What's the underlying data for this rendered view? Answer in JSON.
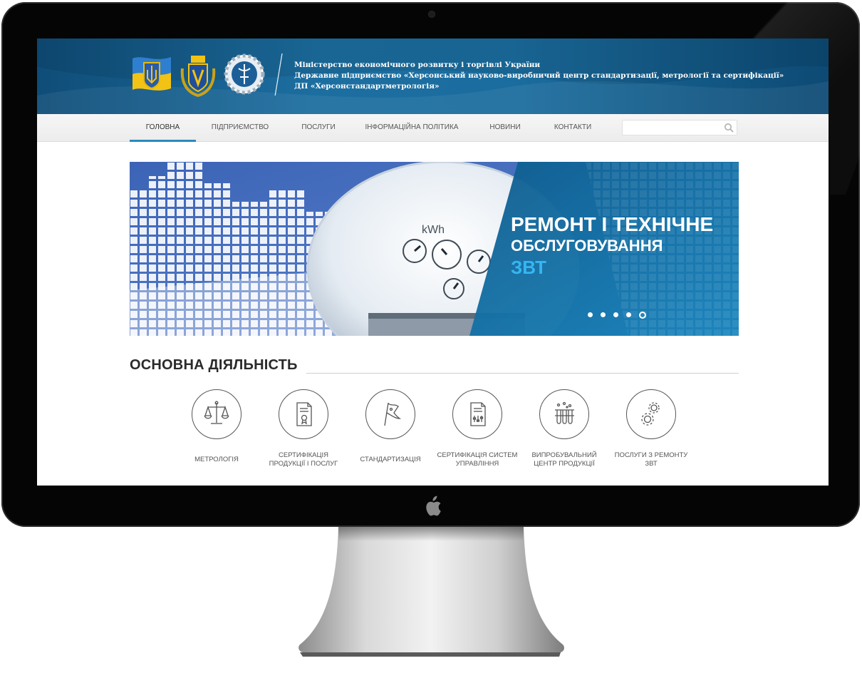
{
  "header": {
    "line1": "Міністерство економічного розвитку і торгівлі України",
    "line2": "Державне підприємство «Херсонський науково-виробничий центр стандартизації, метрології та сертифікації»",
    "line3": "ДП «Херсонстандартметрологія»"
  },
  "nav": {
    "items": [
      {
        "label": "ГОЛОВНА",
        "active": true
      },
      {
        "label": "ПІДПРИЄМСТВО",
        "active": false
      },
      {
        "label": "ПОСЛУГИ",
        "active": false
      },
      {
        "label": "ІНФОРМАЦІЙНА ПОЛІТИКА",
        "active": false
      },
      {
        "label": "НОВИНИ",
        "active": false
      },
      {
        "label": "КОНТАКТИ",
        "active": false
      }
    ],
    "search_value": ""
  },
  "slider": {
    "title_line1": "РЕМОНТ І ТЕХНІЧНЕ",
    "title_line2": "ОБСЛУГОВУВАННЯ",
    "title_line3": "ЗВТ",
    "meter_text": "kWh",
    "slide_count": 5,
    "active_slide": 5
  },
  "activities": {
    "title": "ОСНОВНА ДІЯЛЬНІСТЬ",
    "items": [
      {
        "label": "МЕТРОЛОГІЯ",
        "icon": "scales-icon"
      },
      {
        "label": "СЕРТИФІКАЦІЯ ПРОДУКЦІЇ І ПОСЛУГ",
        "icon": "certificate-icon"
      },
      {
        "label": "СТАНДАРТИЗАЦІЯ",
        "icon": "flag-icon"
      },
      {
        "label": "СЕРТИФІКАЦІЯ СИСТЕМ УПРАВЛІННЯ",
        "icon": "document-settings-icon"
      },
      {
        "label": "ВИПРОБУВАЛЬНИЙ ЦЕНТР ПРОДУКЦІЇ",
        "icon": "test-tubes-icon"
      },
      {
        "label": "ПОСЛУГИ З РЕМОНТУ ЗВТ",
        "icon": "gears-icon"
      }
    ]
  },
  "colors": {
    "header_dark": "#0f4d78",
    "header_mid": "#1c6ea0",
    "accent": "#2a8ac0",
    "slide_highlight": "#35b6f2"
  }
}
